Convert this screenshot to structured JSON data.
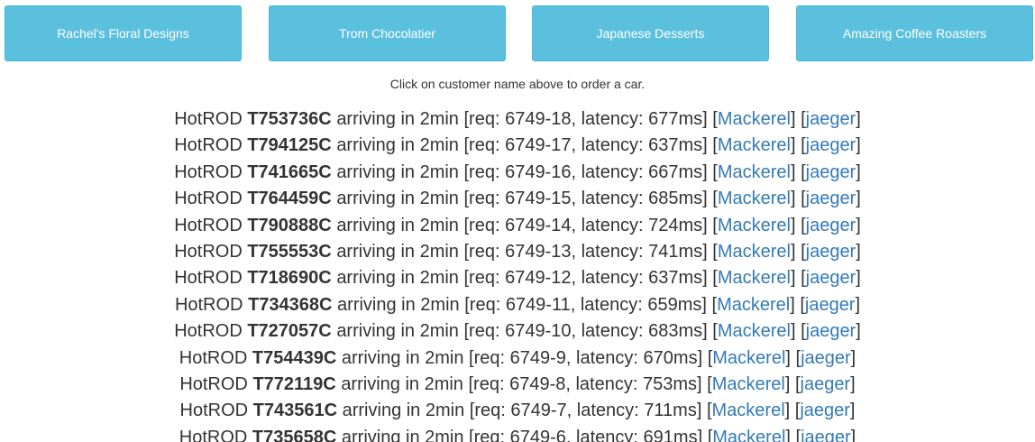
{
  "customers": [
    "Rachel's Floral Designs",
    "Trom Chocolatier",
    "Japanese Desserts",
    "Amazing Coffee Roasters"
  ],
  "hint": "Click on customer name above to order a car.",
  "ride_template": {
    "prefix": "HotROD",
    "arriving": "arriving in 2min",
    "req_label": "req:",
    "latency_label": "latency:",
    "link_mackerel": "Mackerel",
    "link_jaeger": "jaeger"
  },
  "rides": [
    {
      "car": "T753736C",
      "req": "6749-18",
      "latency": "677ms"
    },
    {
      "car": "T794125C",
      "req": "6749-17",
      "latency": "637ms"
    },
    {
      "car": "T741665C",
      "req": "6749-16",
      "latency": "667ms"
    },
    {
      "car": "T764459C",
      "req": "6749-15",
      "latency": "685ms"
    },
    {
      "car": "T790888C",
      "req": "6749-14",
      "latency": "724ms"
    },
    {
      "car": "T755553C",
      "req": "6749-13",
      "latency": "741ms"
    },
    {
      "car": "T718690C",
      "req": "6749-12",
      "latency": "637ms"
    },
    {
      "car": "T734368C",
      "req": "6749-11",
      "latency": "659ms"
    },
    {
      "car": "T727057C",
      "req": "6749-10",
      "latency": "683ms"
    },
    {
      "car": "T754439C",
      "req": "6749-9",
      "latency": "670ms"
    },
    {
      "car": "T772119C",
      "req": "6749-8",
      "latency": "753ms"
    },
    {
      "car": "T743561C",
      "req": "6749-7",
      "latency": "711ms"
    },
    {
      "car": "T735658C",
      "req": "6749-6",
      "latency": "691ms"
    }
  ],
  "colors": {
    "button_bg": "#5bc0de",
    "button_border": "#46b8da",
    "link": "#337ab7",
    "text": "#333333"
  }
}
